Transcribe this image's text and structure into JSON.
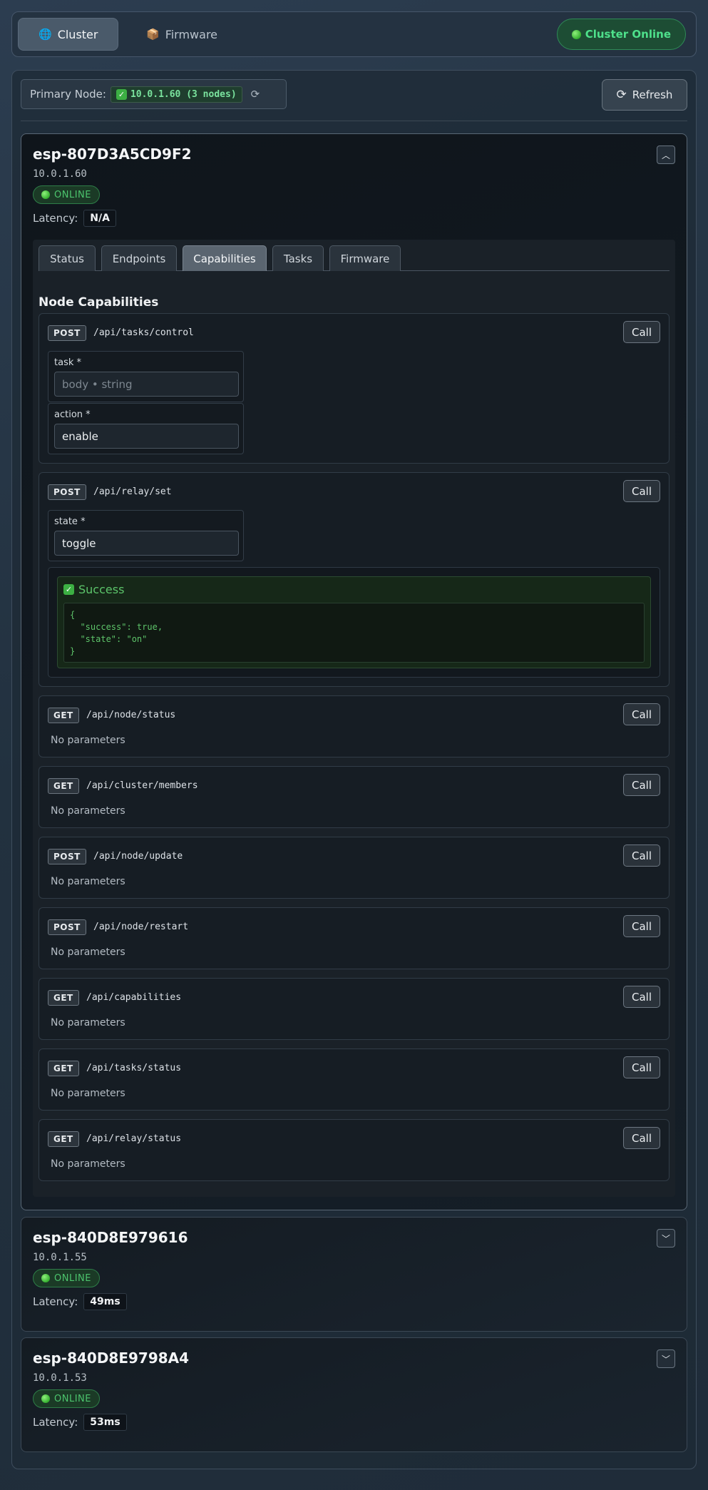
{
  "topnav": {
    "tabs": [
      {
        "icon": "globe-icon",
        "glyph": "🌐",
        "label": "Cluster"
      },
      {
        "icon": "package-icon",
        "glyph": "📦",
        "label": "Firmware"
      }
    ],
    "cluster_status": "Cluster Online"
  },
  "toolbar": {
    "primary_label": "Primary Node:",
    "primary_value": "10.0.1.60 (3 nodes)",
    "refresh_label": "Refresh"
  },
  "nodes": [
    {
      "name": "esp-807D3A5CD9F2",
      "ip": "10.0.1.60",
      "status": "ONLINE",
      "latency_label": "Latency:",
      "latency": "N/A",
      "expanded": true,
      "tabs": [
        "Status",
        "Endpoints",
        "Capabilities",
        "Tasks",
        "Firmware"
      ],
      "active_tab": "Capabilities",
      "section_title": "Node Capabilities",
      "endpoints": [
        {
          "method": "POST",
          "path": "/api/tasks/control",
          "call": "Call",
          "params": [
            {
              "label": "task *",
              "value": "",
              "placeholder": "body • string"
            },
            {
              "label": "action *",
              "value": "enable",
              "placeholder": ""
            }
          ]
        },
        {
          "method": "POST",
          "path": "/api/relay/set",
          "call": "Call",
          "params": [
            {
              "label": "state *",
              "value": "toggle",
              "placeholder": ""
            }
          ],
          "result": {
            "title": "Success",
            "body": "{\n  \"success\": true,\n  \"state\": \"on\"\n}"
          }
        },
        {
          "method": "GET",
          "path": "/api/node/status",
          "call": "Call",
          "no_params": "No parameters"
        },
        {
          "method": "GET",
          "path": "/api/cluster/members",
          "call": "Call",
          "no_params": "No parameters"
        },
        {
          "method": "POST",
          "path": "/api/node/update",
          "call": "Call",
          "no_params": "No parameters"
        },
        {
          "method": "POST",
          "path": "/api/node/restart",
          "call": "Call",
          "no_params": "No parameters"
        },
        {
          "method": "GET",
          "path": "/api/capabilities",
          "call": "Call",
          "no_params": "No parameters"
        },
        {
          "method": "GET",
          "path": "/api/tasks/status",
          "call": "Call",
          "no_params": "No parameters"
        },
        {
          "method": "GET",
          "path": "/api/relay/status",
          "call": "Call",
          "no_params": "No parameters"
        }
      ]
    },
    {
      "name": "esp-840D8E979616",
      "ip": "10.0.1.55",
      "status": "ONLINE",
      "latency_label": "Latency:",
      "latency": "49ms",
      "expanded": false
    },
    {
      "name": "esp-840D8E9798A4",
      "ip": "10.0.1.53",
      "status": "ONLINE",
      "latency_label": "Latency:",
      "latency": "53ms",
      "expanded": false
    }
  ],
  "colors": {
    "online": "#4cc46d",
    "success": "#5cc46a",
    "cluster_online": "#4ee08b"
  }
}
